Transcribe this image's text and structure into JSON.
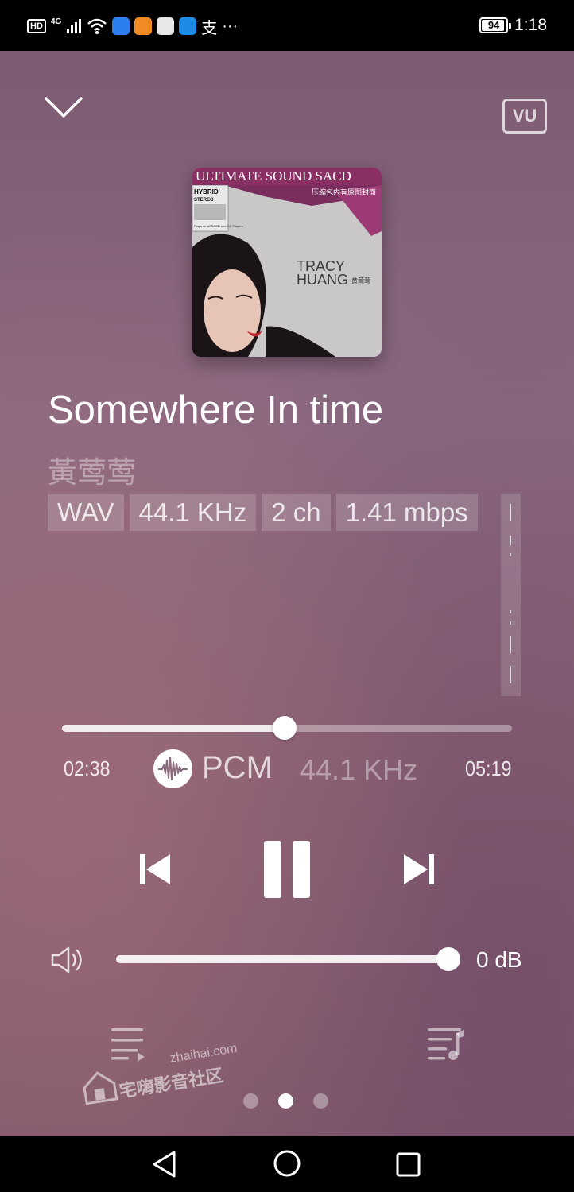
{
  "status_bar": {
    "network": "4G",
    "hd": "HD",
    "extra_glyph": "支",
    "more": "···",
    "battery": "94",
    "battery_level_percent": 94,
    "time": "1:18"
  },
  "album": {
    "banner": "ULTIMATE SOUND SACD",
    "subtitle_cn": "压缩包内有原图封面",
    "hybrid_line1": "HYBRID",
    "hybrid_line2": "STEREO",
    "small_text": "Plays on all SACD and CD Players",
    "artist_line1": "TRACY",
    "artist_line2": "HUANG",
    "artist_cn": "黄莺莺"
  },
  "track": {
    "title": "Somewhere In time",
    "artist": "黃莺莺"
  },
  "format": {
    "chips": [
      "WAV",
      "44.1 KHz",
      "2 ch",
      "1.41 mbps"
    ]
  },
  "progress": {
    "elapsed": "02:38",
    "total": "05:19",
    "fraction": 0.495,
    "codec": "PCM",
    "sample_rate": "44.1 KHz"
  },
  "volume": {
    "value": "0 dB",
    "fraction": 1.0
  },
  "icons": {
    "collapse": "chevron-down-icon",
    "vu": "VU",
    "prev": "skip-previous-icon",
    "pause": "pause-icon",
    "next": "skip-next-icon",
    "volume": "speaker-icon",
    "queue": "play-queue-icon",
    "playlist": "playlist-music-icon"
  },
  "pager": {
    "count": 3,
    "active": 1
  },
  "watermark": {
    "url": "zhaihai.com",
    "name": "宅嗨影音社区"
  }
}
